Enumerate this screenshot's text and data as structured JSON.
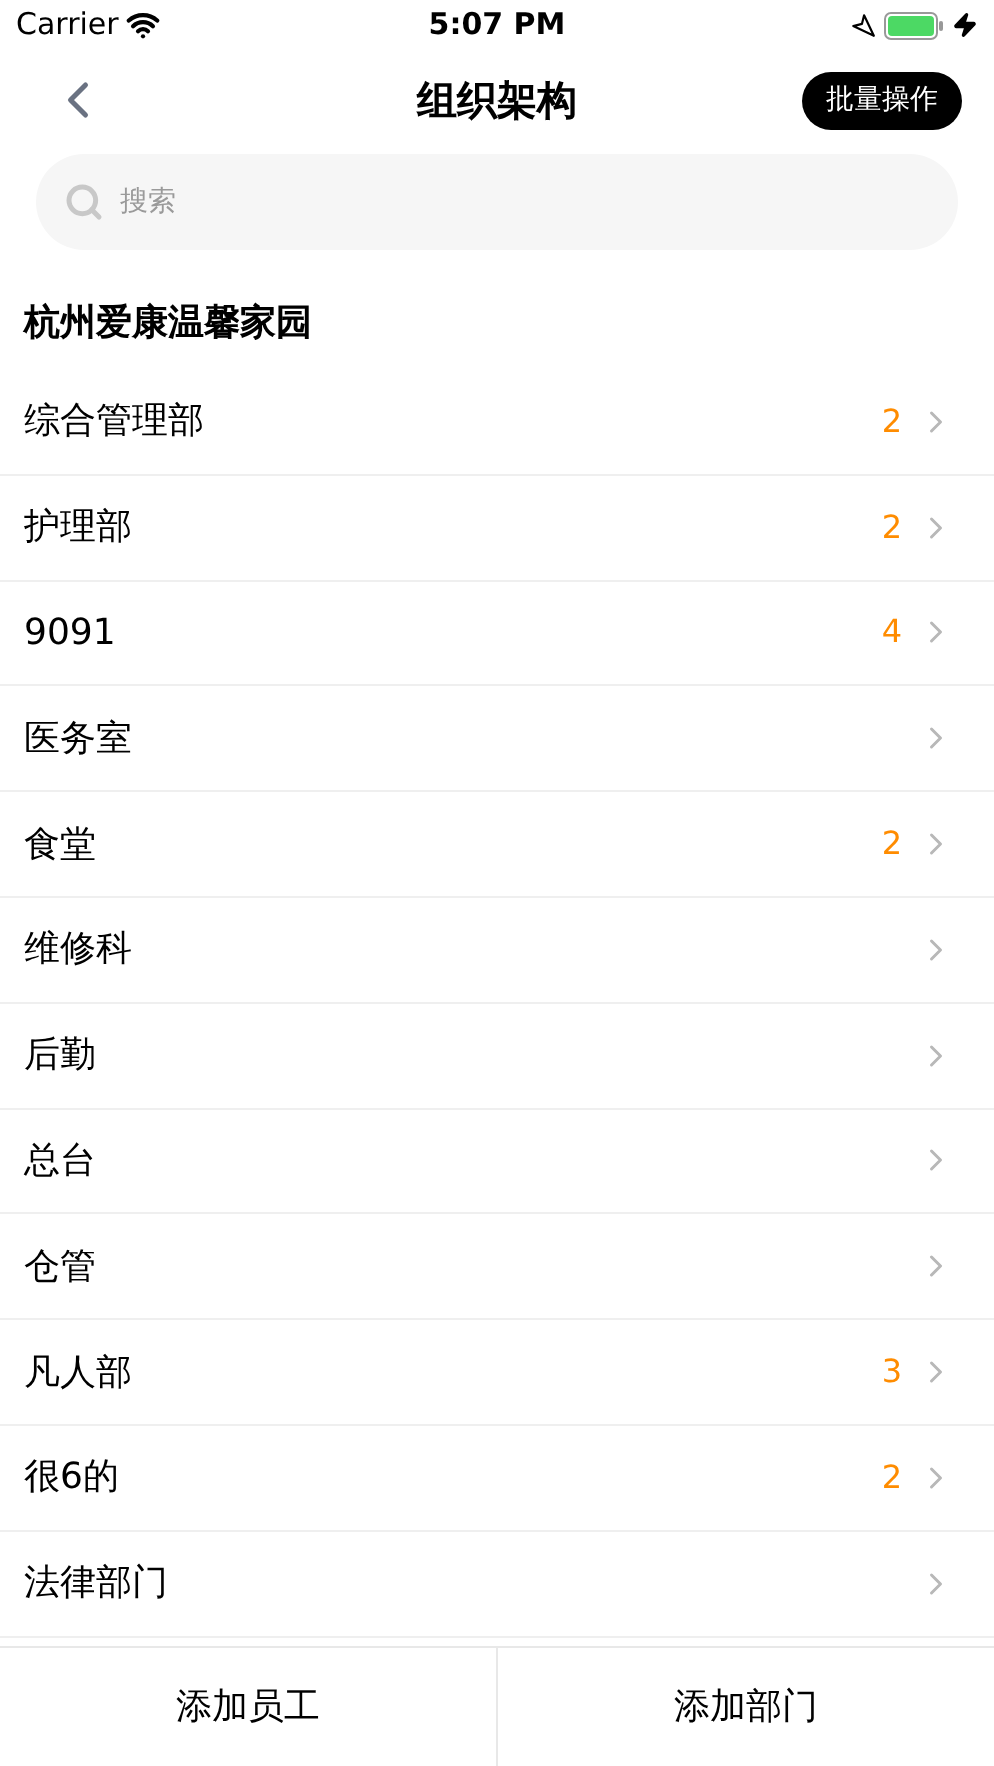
{
  "status_bar": {
    "carrier": "Carrier",
    "time": "5:07 PM"
  },
  "nav": {
    "title": "组织架构",
    "action": "批量操作"
  },
  "search": {
    "placeholder": "搜索"
  },
  "organization": "杭州爱康温馨家园",
  "departments": [
    {
      "name": "综合管理部",
      "count": "2"
    },
    {
      "name": "护理部",
      "count": "2"
    },
    {
      "name": "9091",
      "count": "4"
    },
    {
      "name": "医务室"
    },
    {
      "name": "食堂",
      "count": "2"
    },
    {
      "name": "维修科"
    },
    {
      "name": "后勤"
    },
    {
      "name": "总台"
    },
    {
      "name": "仓管"
    },
    {
      "name": "凡人部",
      "count": "3"
    },
    {
      "name": "很6的",
      "count": "2"
    },
    {
      "name": "法律部门"
    }
  ],
  "footer_buttons": [
    "添加员工",
    "添加部门"
  ]
}
